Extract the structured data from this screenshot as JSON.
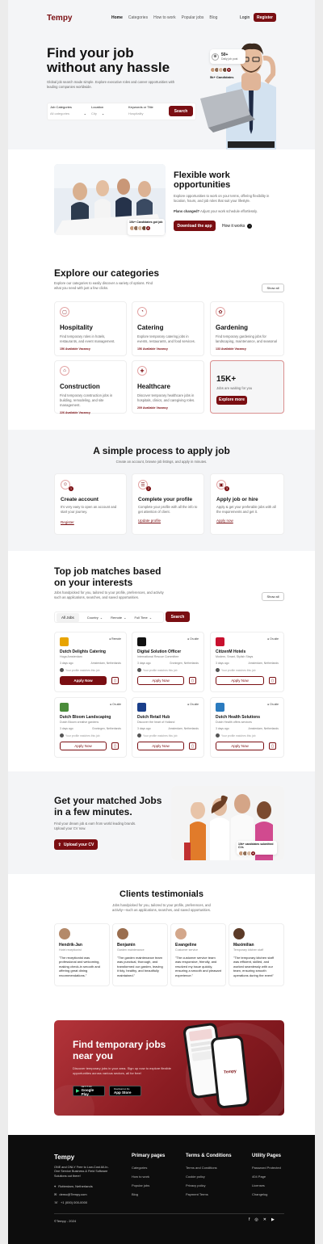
{
  "brand": "Tempy",
  "nav": {
    "links": [
      "Home",
      "Categories",
      "How to work",
      "Popular jobs",
      "Blog"
    ],
    "login": "Login",
    "register": "Register"
  },
  "hero": {
    "title1": "Find your job",
    "title2": "without any hassle",
    "desc": "Global job search made simple. Explore executive roles and career opportunities with leading companies worldwide.",
    "badge_num": "50+",
    "badge_text": "Daily job post",
    "candidates": "5k+ Candidates",
    "fields": [
      {
        "label": "Job Categories",
        "value": "All categories"
      },
      {
        "label": "Location",
        "value": "City"
      },
      {
        "label": "Keywords or Title",
        "value": "Hospitality"
      }
    ],
    "search": "Search"
  },
  "flex": {
    "title1": "Flexible work",
    "title2": "opportunities",
    "desc": "Explore opportunities to work on your terms, offering flexibility in location, hours, and job roles that suit your lifestyle.",
    "plans_bold": "Plans changed?",
    "plans": " Adjust your work schedule effortlessly.",
    "download": "Download the app",
    "how": "How it works",
    "got_job": "10k+ Candidates got job"
  },
  "categories": {
    "title": "Explore our categories",
    "desc": "Explore our categories to easily discover a variety of options. Find what you need with just a few clicks.",
    "show_all": "Show all",
    "items": [
      {
        "name": "Hospitality",
        "desc": "Find temporary roles in hotels, restaurants, and event management.",
        "vac": "156 Available Vacancy",
        "icon": "▢"
      },
      {
        "name": "Catering",
        "desc": "Explore temporary catering jobs in events, restaurants, and food services.",
        "vac": "156 Available Vacancy",
        "icon": "◔"
      },
      {
        "name": "Gardening",
        "desc": "Find temporary gardening jobs for landscaping, maintenance, and seasonal",
        "vac": "133 Available Vacancy",
        "icon": "✿"
      },
      {
        "name": "Construction",
        "desc": "Find temporary construction jobs in building, remodeling, and site management.",
        "vac": "226 Available Vacancy",
        "icon": "⌂"
      },
      {
        "name": "Healthcare",
        "desc": "Discover temporary healthcare jobs in hospitals, clinics, and caregiving roles.",
        "vac": "209 Available Vacancy",
        "icon": "✚"
      }
    ],
    "promo_num": "15K+",
    "promo_text": "Jobs are waiting for you",
    "promo_btn": "Explore more"
  },
  "process": {
    "title": "A simple process to apply job",
    "desc": "Create an account, browse job listings, and apply in minutes.",
    "steps": [
      {
        "n": "1",
        "title": "Create account",
        "desc": "It's very easy to open an account and start your journey.",
        "link": "Register"
      },
      {
        "n": "2",
        "title": "Complete your profile",
        "desc": "Complete your profile with all the info to get attention of client.",
        "link": "Update profile"
      },
      {
        "n": "3",
        "title": "Apply job or hire",
        "desc": "Apply & get your preferable jobs with all the requirements and get it.",
        "link": "Apply now"
      }
    ]
  },
  "matches": {
    "title1": "Top job matches based",
    "title2": "on your interests",
    "desc": "Jobs handpicked for you, tailored to your profile, preferences, and activity such as applications, searches, and saved opportunities.",
    "show_all": "Show all",
    "filters": [
      "All Jobs",
      "Country",
      "Remote",
      "Full Time"
    ],
    "search": "Search",
    "jobs": [
      {
        "company": "Dutch Delights Catering",
        "role": "Hoga Amsterdam",
        "tag": "Remote",
        "age": "3 days ago",
        "loc": "Amsterdam, Netherlands",
        "match": "Your profile matches this job",
        "apply": "Apply Now",
        "logo_color": "#e8a400"
      },
      {
        "company": "Digital Solution Officer",
        "role": "International Rescue Committee",
        "tag": "On-site",
        "age": "3 days ago",
        "loc": "Groningen, Netherlands",
        "match": "Your profile matches this job",
        "apply": "Apply Now",
        "logo_color": "#111"
      },
      {
        "company": "CitizenM Hotels",
        "role": "Modern, Smart, Stylish Stays",
        "tag": "On-site",
        "age": "3 days ago",
        "loc": "Amsterdam, Netherlands",
        "match": "Your profile matches this job",
        "apply": "Apply Now",
        "logo_color": "#c8102e"
      },
      {
        "company": "Dutch Bloom Landscaping",
        "role": "Dutch Bloom creative gardens",
        "tag": "On-site",
        "age": "3 days ago",
        "loc": "Groningen, Netherlands",
        "match": "Your profile matches this job",
        "apply": "Apply Now",
        "logo_color": "#4a8c3a"
      },
      {
        "company": "Dutch Retail Hub",
        "role": "Discover the heart of Holland",
        "tag": "On-site",
        "age": "3 days ago",
        "loc": "Amsterdam, Netherlands",
        "match": "Your profile matches this job",
        "apply": "Apply Now",
        "logo_color": "#1a3f8a"
      },
      {
        "company": "Dutch Health Solutions",
        "role": "Dutch Health offers services",
        "tag": "On-site",
        "age": "3 days ago",
        "loc": "Amsterdam, Netherlands",
        "match": "Your profile matches this job",
        "apply": "Apply Now",
        "logo_color": "#2b7bbf"
      }
    ]
  },
  "matched": {
    "title1": "Get your matched Jobs",
    "title2": "in a few minutes.",
    "desc": "Find your dream job & earn from world leading brands. Upload your CV now.",
    "btn": "Upload your CV",
    "submitted": "10k+ candidates submitted CVs"
  },
  "testimonials": {
    "title": "Clients testimonials",
    "desc": "Jobs handpicked for you, tailored to your profile, preferences, and activity—such as applications, searches, and saved opportunities.",
    "items": [
      {
        "name": "Hendrik-Jan",
        "role": "Hotel receptionist",
        "text": "\"The receptionist was professional and welcoming, making check-in smooth and offering great dining recommendations.\""
      },
      {
        "name": "Benjamin",
        "role": "Garden maintenance",
        "text": "\"The garden maintenance team was punctual, thorough, and transformed our garden, leaving it tidy, healthy, and beautifully maintained.\""
      },
      {
        "name": "Evangeline",
        "role": "Customer service",
        "text": "\"The customer service team was responsive, friendly, and resolved my issue quickly, ensuring a smooth and pleasant experience.\""
      },
      {
        "name": "Maximilian",
        "role": "Temporary kitchen staff",
        "text": "\"The temporary kitchen staff was efficient, skilled, and worked seamlessly with our team, ensuring smooth operations during the event\""
      }
    ]
  },
  "app": {
    "title1": "Find temporary jobs",
    "title2": "near you",
    "desc": "Discover temporary jobs in your area. Sign up now to explore flexible opportunities across various sectors, all for free!",
    "google_small": "GET IT ON",
    "google": "Google Play",
    "apple_small": "Download on the",
    "apple": "App Store",
    "phone_brand": "Tempy"
  },
  "footer": {
    "brand": "Tempy",
    "about": "ONE and ONLY Free to Low-Cost All-In-One Service Business & Field Software Solutions out there!",
    "address": "Rotterdam, Netherlands",
    "email": "demo@Tempy.com",
    "phone": "+1 (000) 000-0000",
    "col1_title": "Primary pages",
    "col1": [
      "Categories",
      "How to work",
      "Popular jobs",
      "Blog"
    ],
    "col2_title": "Terms & Conditions",
    "col2": [
      "Terms and Conditions",
      "Cookie policy",
      "Privacy policy",
      "Payment Terms"
    ],
    "col3_title": "Utility Pages",
    "col3": [
      "Password Protected",
      "404 Page",
      "Licenses",
      "Changelog"
    ],
    "copyright": "©Tempy - 2024"
  },
  "colors": {
    "accent": "#7a0e12",
    "bg_gray": "#f4f5f7",
    "footer": "#0d0d0d"
  }
}
